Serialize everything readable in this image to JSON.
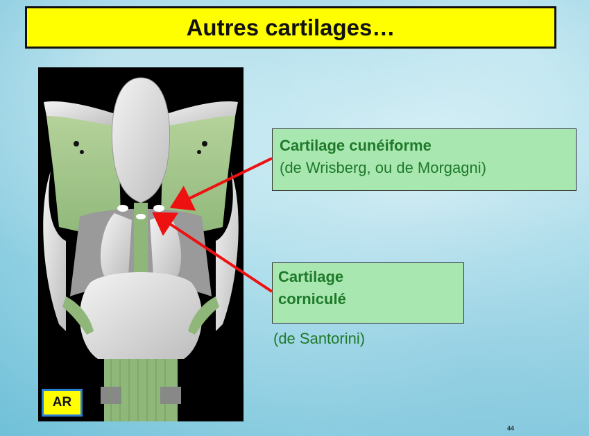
{
  "slide": {
    "title": "Autres cartilages…",
    "view_badge": "AR",
    "page_number": "44"
  },
  "labels": {
    "cuneiform": {
      "name": "Cartilage cunéiforme",
      "detail": "(de Wrisberg, ou de Morgagni)"
    },
    "corniculate": {
      "name_line1": "Cartilage",
      "name_line2": "corniculé",
      "detail": "(de Santorini)"
    }
  },
  "colors": {
    "title_bg": "#ffff00",
    "label_bg": "#a9e7b0",
    "label_text": "#1e7a2a",
    "arrow": "#ee1111",
    "badge_border": "#2a7fd4"
  }
}
